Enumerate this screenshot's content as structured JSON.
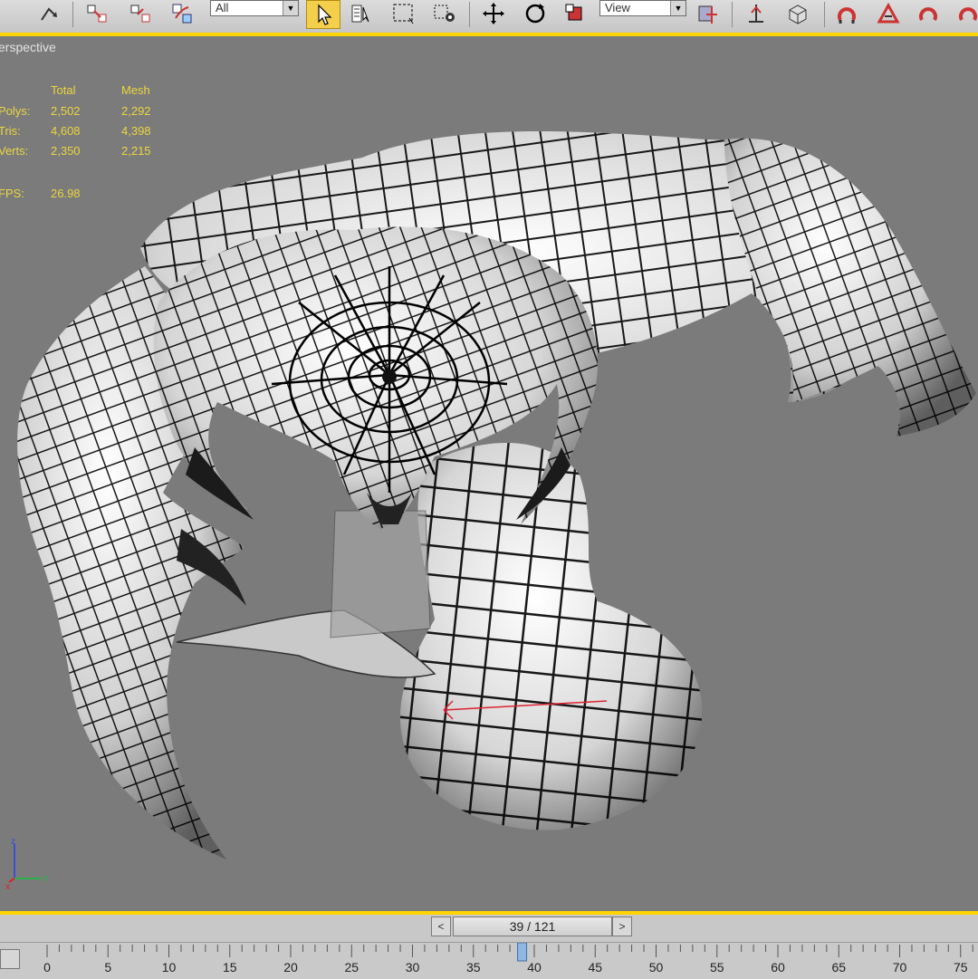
{
  "toolbar": {
    "selection_filter": "All",
    "reference_coord": "View",
    "buttons": [
      {
        "name": "undo-icon"
      },
      {
        "name": "select-and-link-icon"
      },
      {
        "name": "unlink-icon"
      },
      {
        "name": "bind-space-warp-icon"
      },
      {
        "name": "select-object-icon",
        "active": true
      },
      {
        "name": "select-by-name-icon"
      },
      {
        "name": "rectangular-selection-icon"
      },
      {
        "name": "window-crossing-icon"
      },
      {
        "name": "select-and-move-icon"
      },
      {
        "name": "select-and-rotate-icon"
      },
      {
        "name": "select-and-scale-icon"
      },
      {
        "name": "use-pivot-center-icon"
      },
      {
        "name": "select-and-manipulate-icon"
      },
      {
        "name": "snap-toggle-icon"
      },
      {
        "name": "angle-snap-icon"
      },
      {
        "name": "percent-snap-icon"
      },
      {
        "name": "spinner-snap-icon"
      }
    ]
  },
  "viewport": {
    "label": "erspective",
    "accent_color": "#ffd400",
    "background_color": "#7b7b7b",
    "stats": {
      "headers": [
        "Total",
        "Mesh"
      ],
      "rows": [
        {
          "label": "Polys:",
          "total": "2,502",
          "mesh": "2,292"
        },
        {
          "label": "Tris:",
          "total": "4,608",
          "mesh": "4,398"
        },
        {
          "label": "Verts:",
          "total": "2,350",
          "mesh": "2,215"
        }
      ],
      "fps_label": "FPS:",
      "fps_value": "26.98"
    },
    "gizmo": {
      "x": "x",
      "y": "y",
      "z": "z"
    }
  },
  "timeline": {
    "frame_display": "39 / 121",
    "current_frame": 39,
    "ticks": [
      "0",
      "5",
      "10",
      "15",
      "20",
      "25",
      "30",
      "35",
      "40",
      "45",
      "50",
      "55",
      "60",
      "65",
      "70",
      "75"
    ],
    "prev_symbol": "<",
    "next_symbol": ">"
  }
}
